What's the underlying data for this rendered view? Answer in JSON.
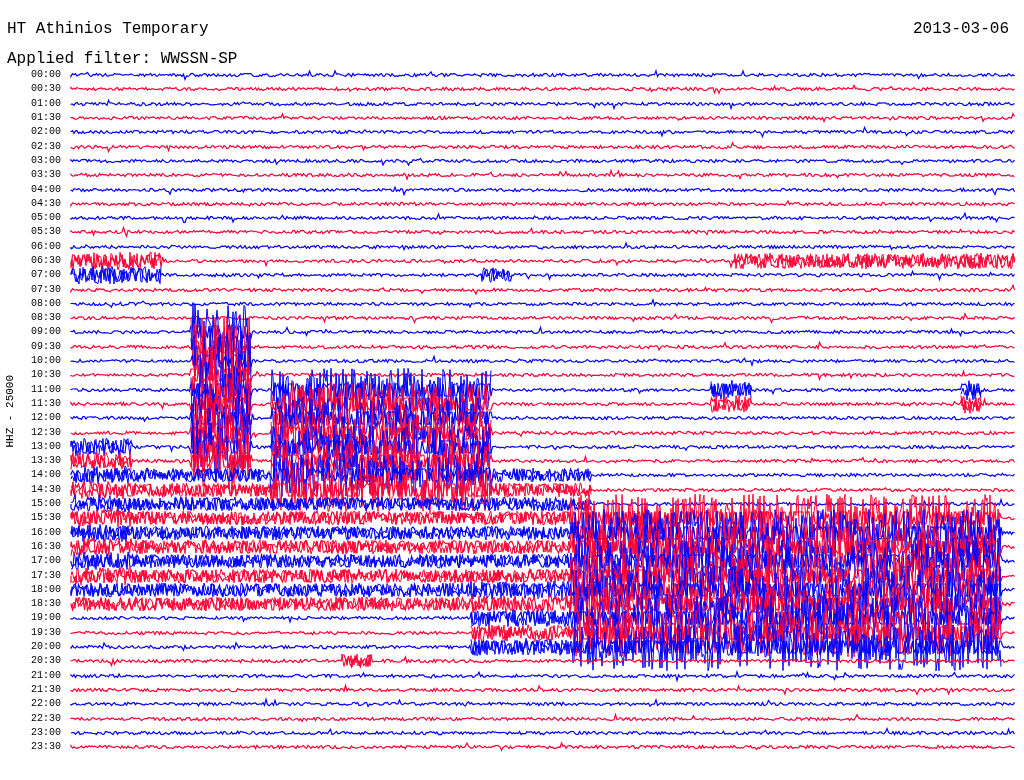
{
  "header": {
    "station": "HT Athinios Temporary",
    "date": "2013-03-06",
    "filter": "Applied filter: WWSSN-SP"
  },
  "axis_label": "HHZ - 25000",
  "traces": [
    {
      "time": "00:00",
      "color": "#0000ff"
    },
    {
      "time": "00:30",
      "color": "#ff0033"
    },
    {
      "time": "01:00",
      "color": "#0000ff"
    },
    {
      "time": "01:30",
      "color": "#ff0033"
    },
    {
      "time": "02:00",
      "color": "#0000ff"
    },
    {
      "time": "02:30",
      "color": "#ff0033"
    },
    {
      "time": "03:00",
      "color": "#0000ff"
    },
    {
      "time": "03:30",
      "color": "#ff0033"
    },
    {
      "time": "04:00",
      "color": "#0000ff"
    },
    {
      "time": "04:30",
      "color": "#ff0033"
    },
    {
      "time": "05:00",
      "color": "#0000ff"
    },
    {
      "time": "05:30",
      "color": "#ff0033"
    },
    {
      "time": "06:00",
      "color": "#0000ff"
    },
    {
      "time": "06:30",
      "color": "#ff0033"
    },
    {
      "time": "07:00",
      "color": "#0000ff"
    },
    {
      "time": "07:30",
      "color": "#ff0033"
    },
    {
      "time": "08:00",
      "color": "#0000ff"
    },
    {
      "time": "08:30",
      "color": "#ff0033"
    },
    {
      "time": "09:00",
      "color": "#0000ff"
    },
    {
      "time": "09:30",
      "color": "#ff0033"
    },
    {
      "time": "10:00",
      "color": "#0000ff"
    },
    {
      "time": "10:30",
      "color": "#ff0033"
    },
    {
      "time": "11:00",
      "color": "#0000ff"
    },
    {
      "time": "11:30",
      "color": "#ff0033"
    },
    {
      "time": "12:00",
      "color": "#0000ff"
    },
    {
      "time": "12:30",
      "color": "#ff0033"
    },
    {
      "time": "13:00",
      "color": "#0000ff"
    },
    {
      "time": "13:30",
      "color": "#ff0033"
    },
    {
      "time": "14:00",
      "color": "#0000ff"
    },
    {
      "time": "14:30",
      "color": "#ff0033"
    },
    {
      "time": "15:00",
      "color": "#0000ff"
    },
    {
      "time": "15:30",
      "color": "#ff0033"
    },
    {
      "time": "16:00",
      "color": "#0000ff"
    },
    {
      "time": "16:30",
      "color": "#ff0033"
    },
    {
      "time": "17:00",
      "color": "#0000ff"
    },
    {
      "time": "17:30",
      "color": "#ff0033"
    },
    {
      "time": "18:00",
      "color": "#0000ff"
    },
    {
      "time": "18:30",
      "color": "#ff0033"
    },
    {
      "time": "19:00",
      "color": "#0000ff"
    },
    {
      "time": "19:30",
      "color": "#ff0033"
    },
    {
      "time": "20:00",
      "color": "#0000ff"
    },
    {
      "time": "20:30",
      "color": "#ff0033"
    },
    {
      "time": "21:00",
      "color": "#0000ff"
    },
    {
      "time": "21:30",
      "color": "#ff0033"
    },
    {
      "time": "22:00",
      "color": "#0000ff"
    },
    {
      "time": "22:30",
      "color": "#ff0033"
    },
    {
      "time": "23:00",
      "color": "#0000ff"
    },
    {
      "time": "23:30",
      "color": "#ff0033"
    }
  ]
}
